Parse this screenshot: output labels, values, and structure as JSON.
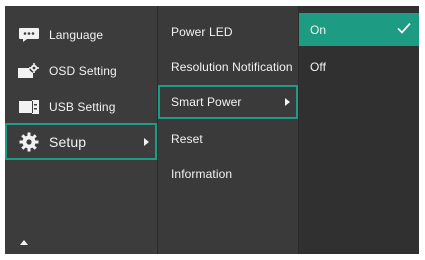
{
  "main_menu": {
    "items": [
      {
        "label": "Language",
        "icon": "language-icon"
      },
      {
        "label": "OSD Setting",
        "icon": "osd-setting-icon"
      },
      {
        "label": "USB Setting",
        "icon": "usb-setting-icon"
      },
      {
        "label": "Setup",
        "icon": "gear-icon"
      }
    ],
    "active_index": 3,
    "scroll_icon": "scroll-up-icon"
  },
  "sub_menu": {
    "items": [
      {
        "label": "Power LED"
      },
      {
        "label": "Resolution Notification"
      },
      {
        "label": "Smart Power"
      },
      {
        "label": "Reset"
      },
      {
        "label": "Information"
      }
    ],
    "active_index": 2
  },
  "options": {
    "items": [
      {
        "label": "On"
      },
      {
        "label": "Off"
      }
    ],
    "selected_index": 0,
    "check_icon": "checkmark-icon"
  },
  "colors": {
    "accent": "#1e9c83",
    "panel_main": "#3c3c3c",
    "panel_sub": "#3a3a3a",
    "panel_options": "#303030",
    "text": "#f2f2f2"
  }
}
